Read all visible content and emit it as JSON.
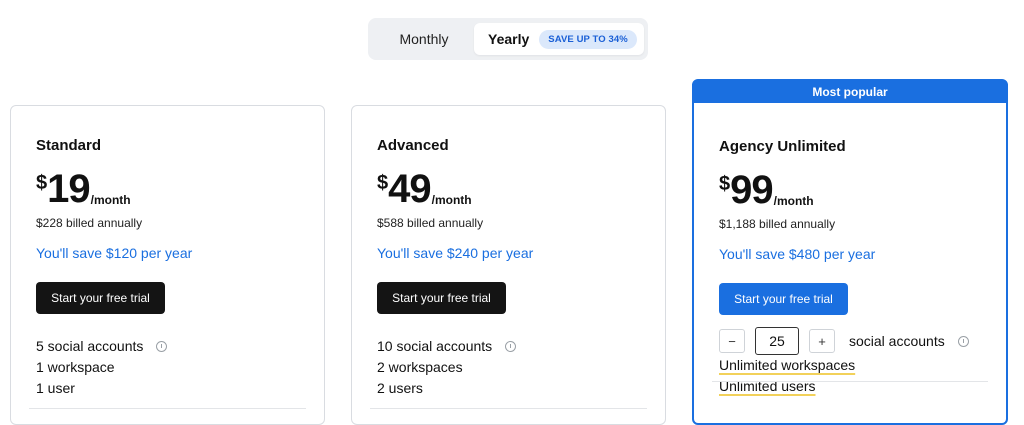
{
  "billing_toggle": {
    "monthly_label": "Monthly",
    "yearly_label": "Yearly",
    "save_badge": "SAVE UP TO 34%"
  },
  "colors": {
    "accent": "#1a6fe0",
    "dark_button": "#141414",
    "badge_bg": "#dbe8fb",
    "underline": "#f2d15a"
  },
  "plans": [
    {
      "name": "Standard",
      "currency": "$",
      "amount": "19",
      "period": "/month",
      "billed": "$228 billed annually",
      "save": "You'll save $120 per year",
      "cta": "Start your free trial",
      "features": [
        "5 social accounts",
        "1 workspace",
        "1 user"
      ]
    },
    {
      "name": "Advanced",
      "currency": "$",
      "amount": "49",
      "period": "/month",
      "billed": "$588 billed annually",
      "save": "You'll save $240 per year",
      "cta": "Start your free trial",
      "features": [
        "10 social accounts",
        "2 workspaces",
        "2 users"
      ]
    },
    {
      "badge": "Most popular",
      "name": "Agency Unlimited",
      "currency": "$",
      "amount": "99",
      "period": "/month",
      "billed": "$1,188 billed annually",
      "save": "You'll save $480 per year",
      "cta": "Start your free trial",
      "stepper": {
        "minus": "−",
        "value": "25",
        "plus": "+",
        "label": "social accounts"
      },
      "features": [
        "Unlimited workspaces",
        "Unlimited users"
      ]
    }
  ]
}
